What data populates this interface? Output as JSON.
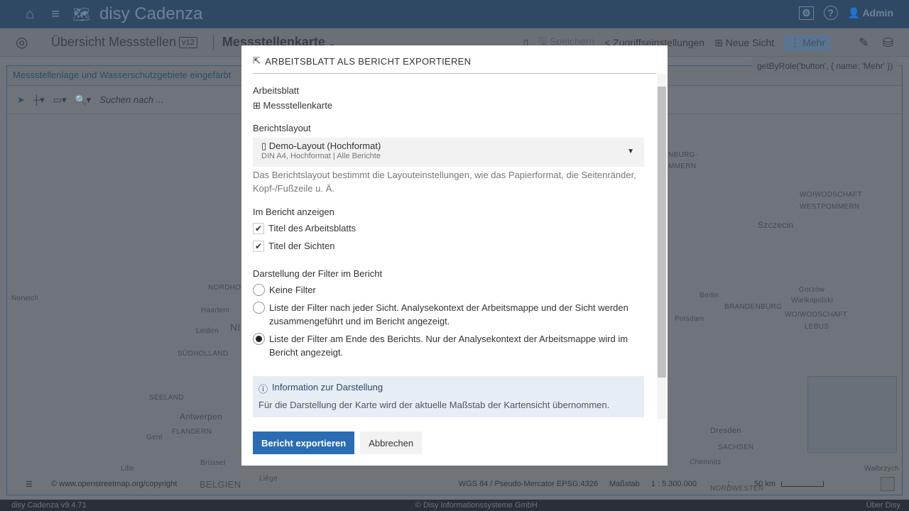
{
  "app": {
    "title": "disy Cadenza",
    "user": "Admin"
  },
  "toolbar": {
    "workbook": "Übersicht Messstellen",
    "version": "v12",
    "sheet": "Messstellenkarte",
    "save": "Speichern",
    "access": "Zugriffseinstellungen",
    "new_view": "Neue Sicht",
    "more": "Mehr"
  },
  "tooltip": "getByRole('button', { name: 'Mehr' })",
  "view": {
    "title": "Messstellenlage und Wasserschutzgebiete eingefärbt",
    "search_placeholder": "Suchen nach ..."
  },
  "map": {
    "labels": [
      "Norwich",
      "NORDHOL",
      "Haarlem",
      "Leiden",
      "NI",
      "SÜDHOLLAND",
      "SEELAND",
      "Antwerpen",
      "FLANDERN",
      "Gent",
      "Brüssel",
      "Lille",
      "Liège",
      "BELGIEN",
      "NBURG-",
      "MMERN",
      "WOIWODSCHAFT",
      "WESTPOMMERN",
      "Szczecin",
      "Berlin",
      "Potsdam",
      "BRANDENBURG",
      "Gorzów",
      "Wielkopolski",
      "WOIWODSCHAFT",
      "LEBUS",
      "Dresden",
      "SACHSEN",
      "Chemnitz",
      "Wałbrzych",
      "NORDWESTEN"
    ],
    "copyright": "© www.openstreetmap.org/copyright",
    "crs": "WGS 84 / Pseudo-Mercator EPSG:4326",
    "scale_label": "Maßstab",
    "scale": "1 : 5.300.000",
    "scalebar": "50 km"
  },
  "footer": {
    "version": "disy Cadenza v9.4.71",
    "copyright": "© Disy Informationssysteme GmbH",
    "about": "Über Disy"
  },
  "dialog": {
    "title": "ARBEITSBLATT ALS BERICHT EXPORTIEREN",
    "sheet_label": "Arbeitsblatt",
    "sheet_value": "Messstellenkarte",
    "layout_label": "Berichtslayout",
    "layout_value": "Demo-Layout (Hochformat)",
    "layout_sub1": "DIN A4, Hochformat",
    "layout_sub2": "Alle Berichte",
    "layout_help": "Das Berichtslayout bestimmt die Layouteinstellungen, wie das Papierformat, die Seitenränder, Kopf-/Fußzeile u. Ä.",
    "show_label": "Im Bericht anzeigen",
    "checkboxes": [
      {
        "label": "Titel des Arbeitsblatts",
        "checked": true
      },
      {
        "label": "Titel der Sichten",
        "checked": true
      }
    ],
    "filter_label": "Darstellung der Filter im Bericht",
    "radios": [
      {
        "label": "Keine Filter",
        "selected": false
      },
      {
        "label": "Liste der Filter nach jeder Sicht. Analysekontext der Arbeitsmappe und der Sicht werden zusammengeführt und im Bericht angezeigt.",
        "selected": false
      },
      {
        "label": "Liste der Filter am Ende des Berichts. Nur der Analysekontext der Arbeitsmappe wird im Bericht angezeigt.",
        "selected": true
      }
    ],
    "info_title": "Information zur Darstellung",
    "info_text": "Für die Darstellung der Karte wird der aktuelle Maßstab der Kartensicht übernommen.",
    "export": "Bericht exportieren",
    "cancel": "Abbrechen"
  }
}
